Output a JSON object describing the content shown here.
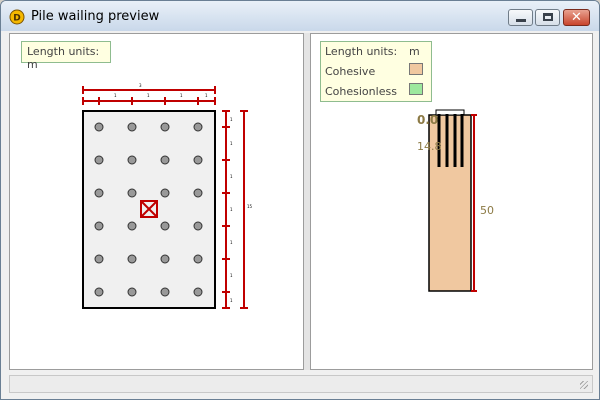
{
  "window": {
    "title": "Pile wailing preview"
  },
  "left_panel": {
    "legend": "Length units: m",
    "dim_total_width": "3",
    "dim_width_segments": [
      "1",
      "1",
      "1",
      "1"
    ],
    "dim_right_segments": [
      "1",
      "1",
      "1",
      "1",
      "1",
      "1",
      "1"
    ],
    "dim_total_height": "15"
  },
  "right_panel": {
    "legend_title": "Length units:",
    "legend_unit": "m",
    "legend_cohesive": "Cohesive",
    "legend_cohesionless": "Cohesionless",
    "depth_top": "0.0",
    "depth_pile_bottom": "14.8",
    "depth_soil_bottom": "50"
  },
  "colors": {
    "cohesive": "#f0c8a0",
    "cohesionless": "#9de89d",
    "dimension": "#c00000",
    "pile": "#999999",
    "center_marker": "#c00000"
  }
}
